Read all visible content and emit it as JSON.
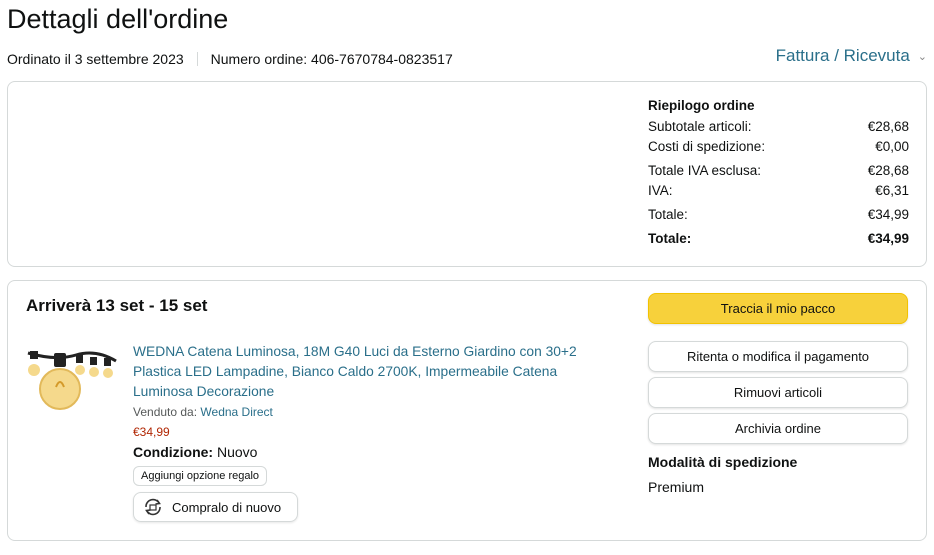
{
  "page": {
    "title": "Dettagli dell'ordine",
    "ordered_on": "Ordinato il 3 settembre 2023",
    "order_number": "Numero ordine: 406-7670784-0823517",
    "invoice_link": "Fattura / Ricevuta"
  },
  "summary": {
    "heading": "Riepilogo ordine",
    "rows": [
      {
        "label": "Subtotale articoli:",
        "value": "€28,68"
      },
      {
        "label": "Costi di spedizione:",
        "value": "€0,00"
      },
      {
        "label": "Totale IVA esclusa:",
        "value": "€28,68"
      },
      {
        "label": "IVA:",
        "value": "€6,31"
      },
      {
        "label": "Totale:",
        "value": "€34,99"
      }
    ],
    "grand_total_label": "Totale:",
    "grand_total_value": "€34,99"
  },
  "shipment": {
    "arrival": "Arriverà 13 set - 15 set",
    "product": {
      "title": "WEDNA Catena Luminosa, 18M G40 Luci da Esterno Giardino con 30+2 Plastica LED Lampadine, Bianco Caldo 2700K, Impermeabile Catena Luminosa Decorazione",
      "seller_prefix": "Venduto da:",
      "seller": "Wedna Direct",
      "price": "€34,99",
      "condition_label": "Condizione:",
      "condition_value": "Nuovo",
      "gift_button": "Aggiungi opzione regalo",
      "buy_again_button": "Compralo di nuovo"
    },
    "actions": {
      "track": "Traccia il mio pacco",
      "retry_payment": "Ritenta o modifica il pagamento",
      "remove_items": "Rimuovi articoli",
      "archive": "Archivia ordine"
    },
    "shipping_method_label": "Modalità di spedizione",
    "shipping_method_value": "Premium"
  },
  "colors": {
    "link": "#2a6f8a",
    "price": "#b12704",
    "primary_button": "#f7d13b",
    "border": "#d5d9d9"
  }
}
